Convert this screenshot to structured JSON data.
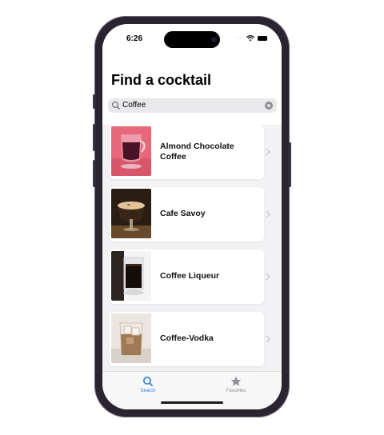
{
  "status_bar": {
    "time": "6:26"
  },
  "header": {
    "title": "Find a cocktail"
  },
  "search": {
    "value": "Coffee"
  },
  "results": [
    {
      "name": "Almond Chocolate Coffee",
      "image": "red-cocktail-photo"
    },
    {
      "name": "Cafe Savoy",
      "image": "foamy-coffee-cocktail-photo"
    },
    {
      "name": "Coffee Liqueur",
      "image": "dark-liqueur-glass-photo"
    },
    {
      "name": "Coffee-Vodka",
      "image": "iced-coffee-vodka-photo"
    }
  ],
  "tab_bar": {
    "tabs": [
      {
        "label": "Search",
        "icon": "search-icon",
        "active": true
      },
      {
        "label": "Favorites",
        "icon": "star-icon",
        "active": false
      }
    ]
  },
  "colors": {
    "accent": "#2f7fd6",
    "inactive": "#8e8e93",
    "title": "#000000"
  }
}
